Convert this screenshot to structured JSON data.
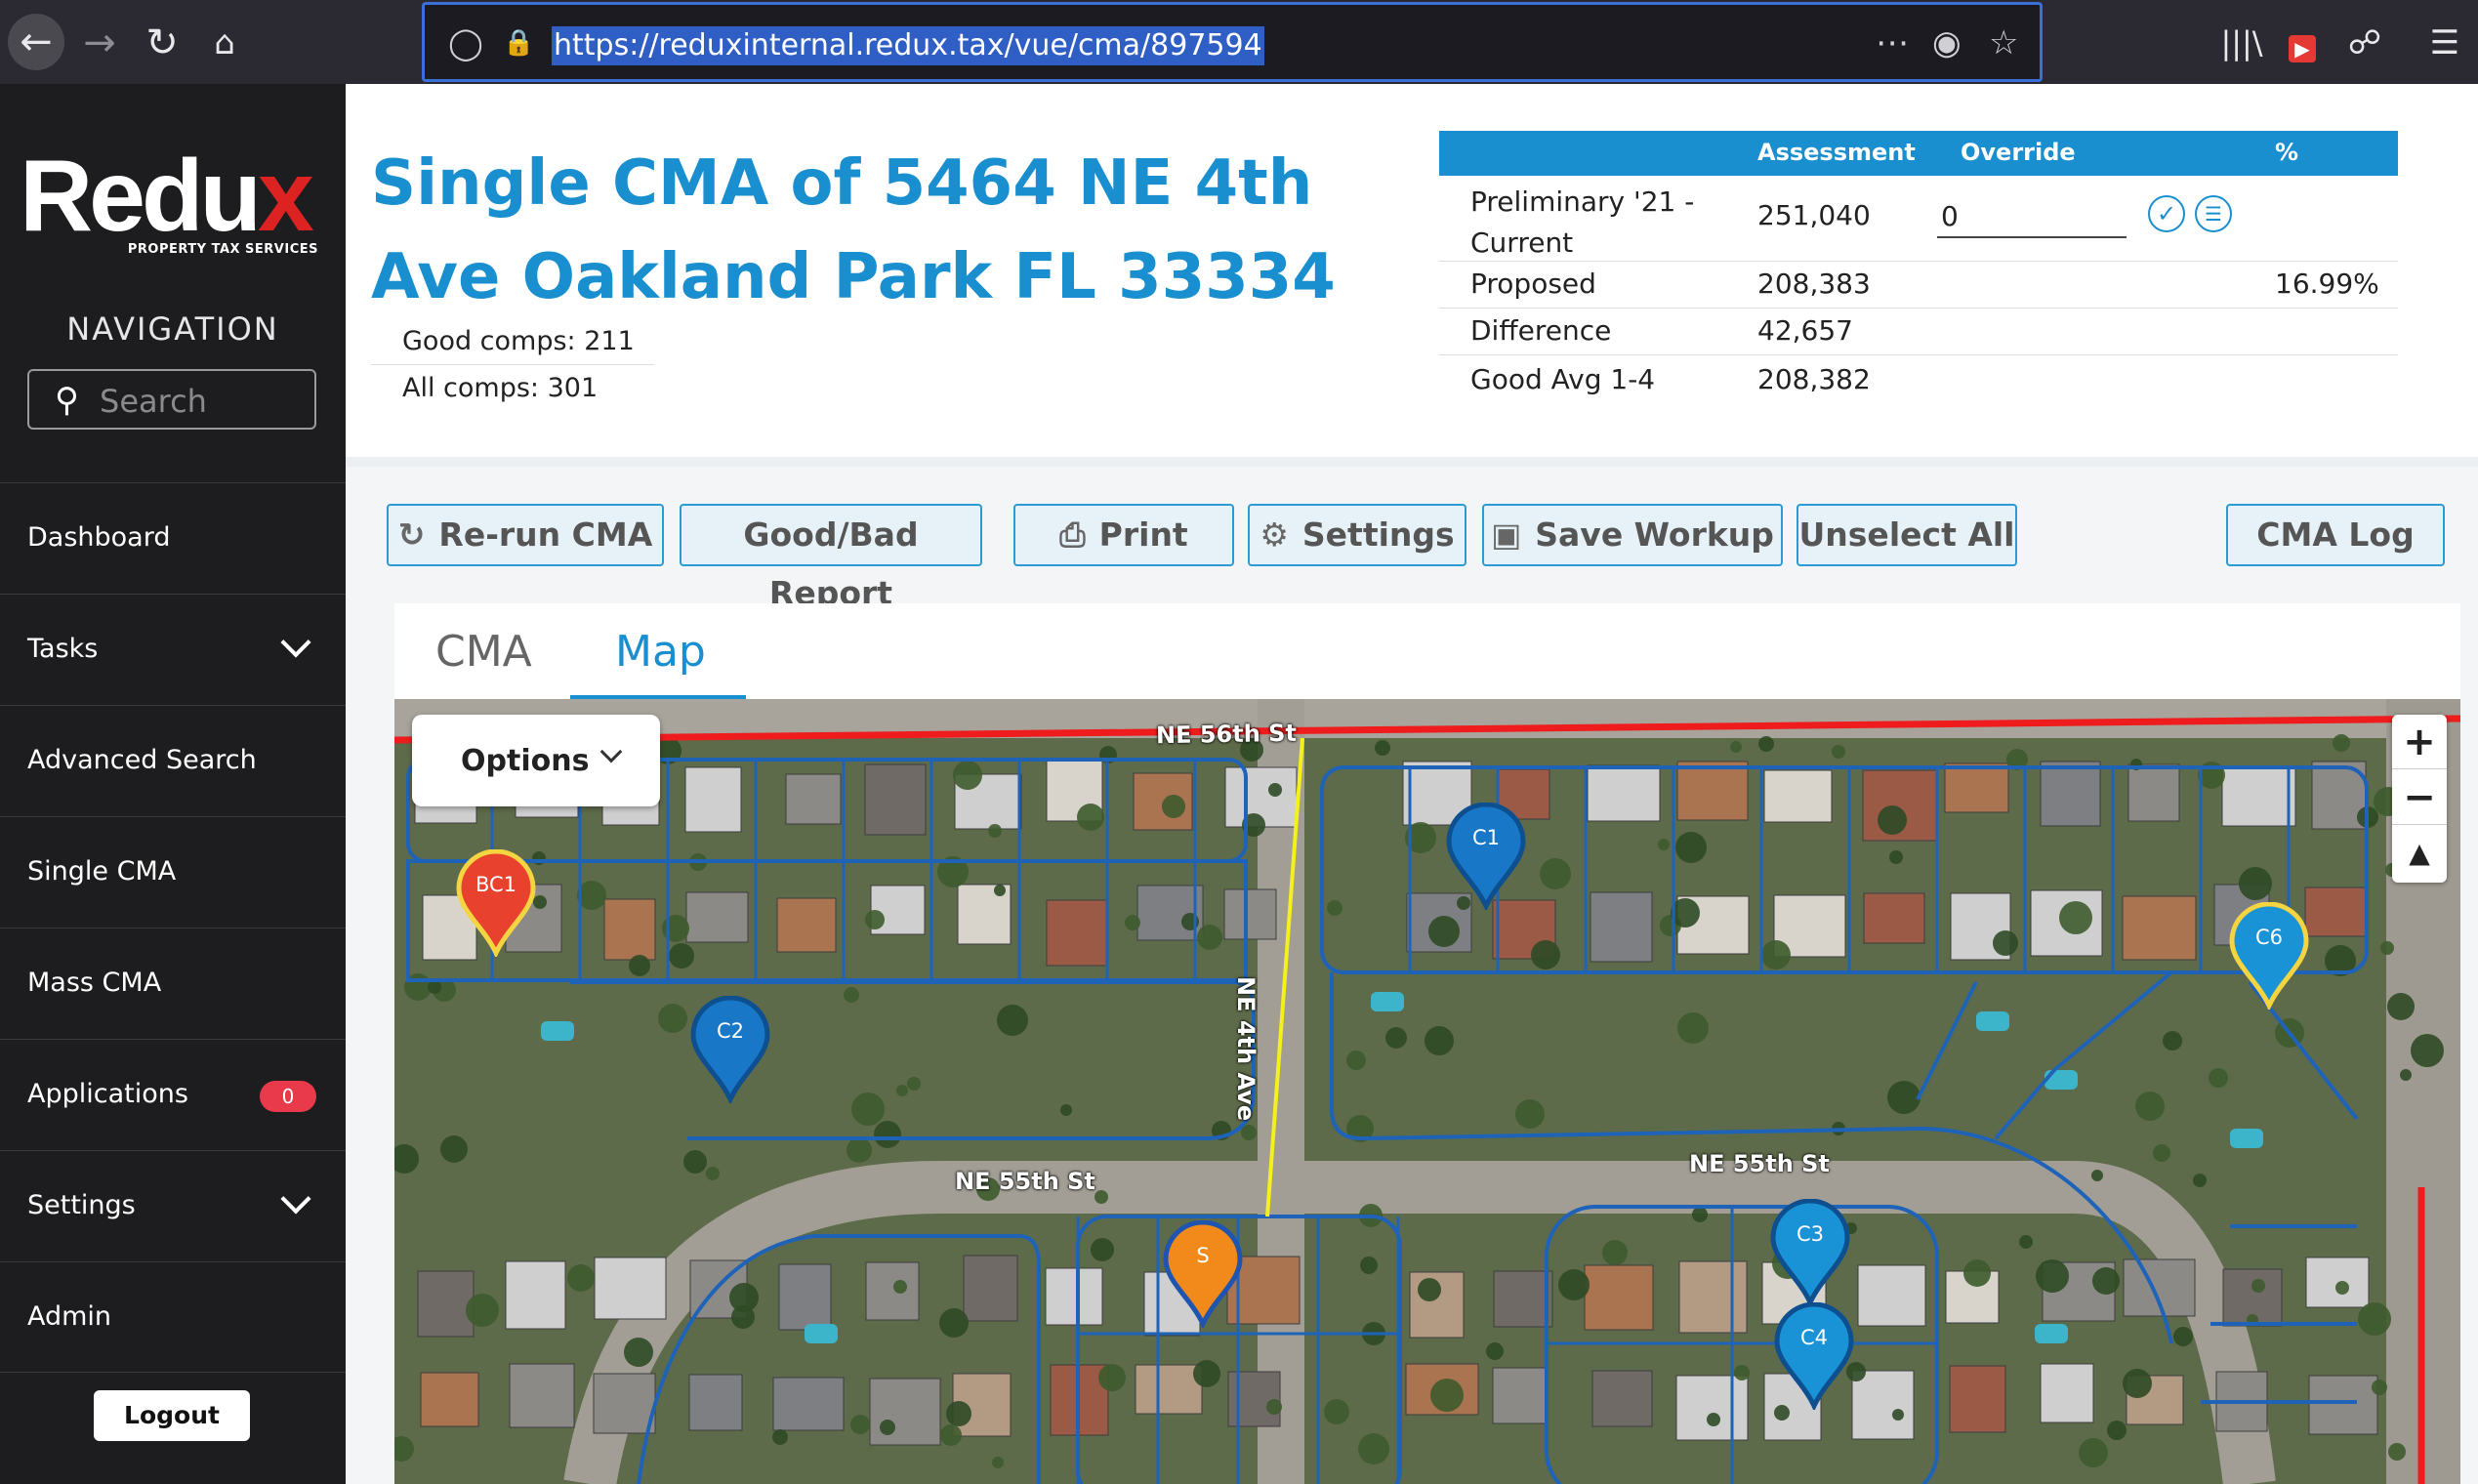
{
  "browser": {
    "url": "https://reduxinternal.redux.tax/vue/cma/897594"
  },
  "sidebar": {
    "logo_text": "Redux",
    "logo_tagline": "PROPERTY TAX SERVICES",
    "nav_heading": "NAVIGATION",
    "search_placeholder": "Search",
    "items": [
      {
        "label": "Dashboard"
      },
      {
        "label": "Tasks",
        "expandable": true
      },
      {
        "label": "Advanced Search"
      },
      {
        "label": "Single CMA"
      },
      {
        "label": "Mass CMA"
      },
      {
        "label": "Applications",
        "badge": "0"
      },
      {
        "label": "Settings",
        "expandable": true
      },
      {
        "label": "Admin"
      }
    ],
    "logout_label": "Logout"
  },
  "header": {
    "title": "Single CMA of 5464 NE 4th Ave Oakland Park FL 33334",
    "good_comps": "Good comps: 211",
    "all_comps": "All comps: 301"
  },
  "assessment_table": {
    "headers": {
      "assessment": "Assessment",
      "override": "Override",
      "percent": "%"
    },
    "rows": [
      {
        "label": "Preliminary '21 - Current",
        "assessment": "251,040",
        "override": "0",
        "percent": ""
      },
      {
        "label": "Proposed",
        "assessment": "208,383",
        "percent": "16.99%"
      },
      {
        "label": "Difference",
        "assessment": "42,657",
        "percent": ""
      },
      {
        "label": "Good Avg 1-4",
        "assessment": "208,382",
        "percent": ""
      }
    ]
  },
  "toolbar": {
    "rerun": "Re-run CMA",
    "goodbad": "Good/Bad Report",
    "print": "Print",
    "settings": "Settings",
    "save": "Save Workup",
    "unselect": "Unselect All",
    "cmalog": "CMA Log"
  },
  "tabs": {
    "cma": "CMA",
    "map": "Map",
    "active": "Map"
  },
  "map": {
    "options_label": "Options",
    "street_labels": [
      "NE 56th St",
      "NE 4th Ave",
      "NE 55th St",
      "NE 55th St"
    ],
    "markers": [
      {
        "label": "BC1",
        "color": "#e8412e",
        "outline": "#f5d442"
      },
      {
        "label": "C1",
        "color": "#1877c6",
        "outline": "#0d4f8f"
      },
      {
        "label": "C2",
        "color": "#1877c6",
        "outline": "#0d4f8f"
      },
      {
        "label": "C6",
        "color": "#1a93d6",
        "outline": "#f5d442"
      },
      {
        "label": "S",
        "color": "#f28a1b",
        "outline": "#1d55b0"
      },
      {
        "label": "C3",
        "color": "#1a93d6",
        "outline": "#0d4f8f"
      },
      {
        "label": "C4",
        "color": "#1a93d6",
        "outline": "#0d4f8f"
      }
    ],
    "colors": {
      "parcel_lines": "#1e63b8",
      "boundary": "#ee1c1c",
      "highlight_road": "#f4f01a"
    }
  }
}
